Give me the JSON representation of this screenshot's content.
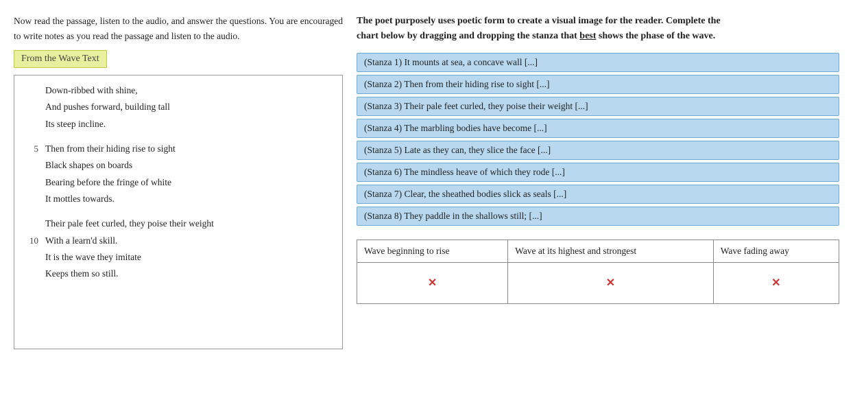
{
  "left": {
    "instructions": "Now read the passage, listen to the audio, and answer the questions. You are encouraged to write notes as you read the passage and listen to the audio.",
    "wave_label": "From the Wave Text",
    "poem_lines": [
      {
        "num": "",
        "text": "Down-ribbed with shine,"
      },
      {
        "num": "",
        "text": "And pushes forward, building tall"
      },
      {
        "num": "",
        "text": "Its steep incline."
      },
      {
        "num": "",
        "text": ""
      },
      {
        "num": "5",
        "text": "Then from their hiding rise to sight"
      },
      {
        "num": "",
        "text": "Black shapes on boards"
      },
      {
        "num": "",
        "text": "Bearing before the fringe of white"
      },
      {
        "num": "",
        "text": "It mottles towards."
      },
      {
        "num": "",
        "text": ""
      },
      {
        "num": "",
        "text": "Their pale feet curled, they poise their weight"
      },
      {
        "num": "10",
        "text": "With a learn'd skill."
      },
      {
        "num": "",
        "text": "It is the wave they imitate"
      },
      {
        "num": "",
        "text": "Keeps them so still."
      }
    ]
  },
  "right": {
    "instructions_line1": "The poet purposely uses poetic form to create a visual image for the reader. Complete the",
    "instructions_line2": "chart below by dragging and dropping the stanza that ",
    "instructions_underline": "best",
    "instructions_line3": " shows the phase of the wave.",
    "stanzas": [
      "(Stanza 1) It mounts at sea, a concave wall [...]",
      "(Stanza 2) Then from their hiding rise to sight [...]",
      "(Stanza 3) Their pale feet curled, they poise their weight [...]",
      "(Stanza 4) The marbling bodies have become [...]",
      "(Stanza 5) Late as they can, they slice the face [...]",
      "(Stanza 6) The mindless heave of which they rode [...]",
      "(Stanza 7) Clear, the sheathed bodies slick as seals [...]",
      "(Stanza 8) They paddle in the shallows still; [...]"
    ],
    "table": {
      "col1_header": "Wave beginning to rise",
      "col2_header": "Wave at its highest and strongest",
      "col3_header": "Wave fading away"
    }
  }
}
